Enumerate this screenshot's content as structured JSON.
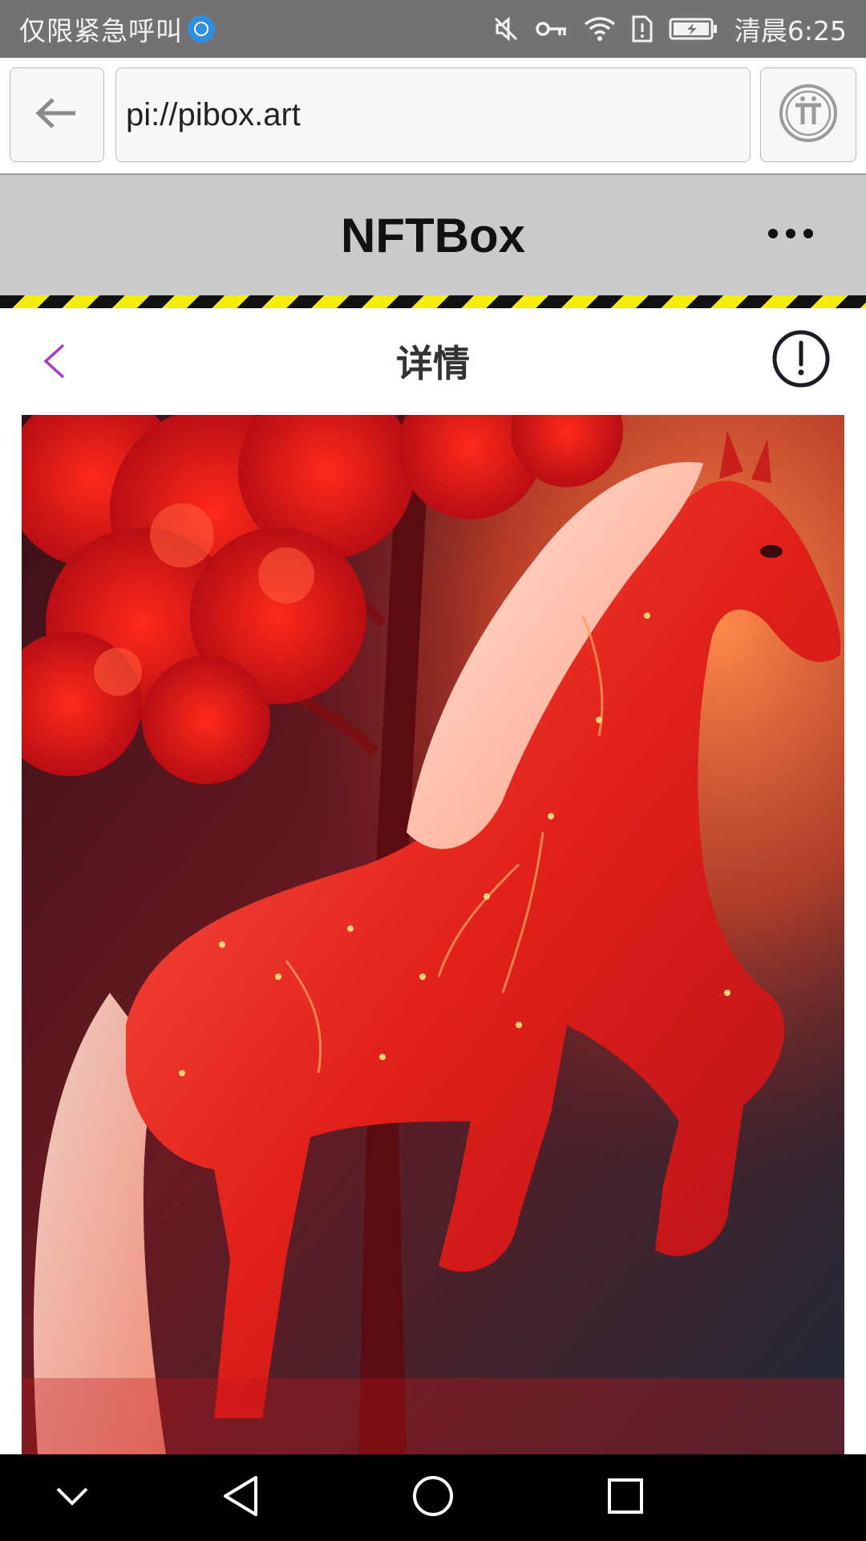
{
  "status_bar": {
    "carrier_text": "仅限紧急呼叫",
    "time": "清晨6:25",
    "icons": [
      "app-notification-icon",
      "mute-icon",
      "key-icon",
      "wifi-icon",
      "sim-alert-icon",
      "battery-charging-icon"
    ]
  },
  "browser": {
    "url": "pi://pibox.art",
    "back_icon": "arrow-left-icon",
    "pi_icon": "pi-network-icon"
  },
  "app_header": {
    "title": "NFTBox",
    "more_icon": "more-horizontal-icon"
  },
  "page": {
    "title": "详情",
    "back_icon": "chevron-left-icon",
    "info_icon": "exclamation-circle-icon"
  },
  "artwork": {
    "subject": "red glowing horse beside red tree"
  },
  "navigation_bar": {
    "buttons": [
      "collapse-icon",
      "back-triangle-icon",
      "home-circle-icon",
      "recents-square-icon"
    ]
  },
  "colors": {
    "status_bar_bg": "#727272",
    "header_bg": "#cacaca",
    "hazard_yellow": "#f5ee0c",
    "accent_purple": "#a23cc6",
    "nav_bar_bg": "#000000"
  }
}
